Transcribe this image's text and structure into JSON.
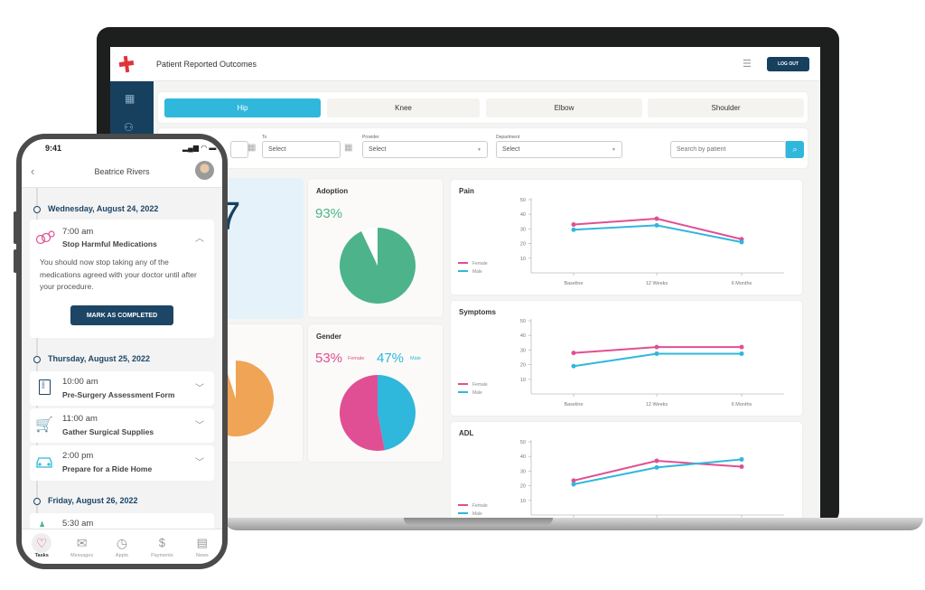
{
  "app": {
    "title": "Patient Reported Outcomes",
    "logout_label": "LOG OUT",
    "brand_color": "#e0343a",
    "accent": "#2fb8dc",
    "navy": "#17405f"
  },
  "tabs": [
    {
      "label": "Hip",
      "active": true
    },
    {
      "label": "Knee"
    },
    {
      "label": "Elbow"
    },
    {
      "label": "Shoulder"
    }
  ],
  "filters": {
    "to_label": "To",
    "to_value": "Select",
    "provider_label": "Provider",
    "provider_value": "Select",
    "department_label": "Department",
    "department_value": "Select",
    "search_placeholder": "Search by patient"
  },
  "stat_card": {
    "value_fragment": "7"
  },
  "adoption": {
    "title": "Adoption",
    "value": "93%",
    "percent": 93,
    "color": "#4db38a"
  },
  "orange_pie": {
    "percent": 95,
    "color": "#f0a456"
  },
  "gender": {
    "title": "Gender",
    "female_value": "53%",
    "female_label": "Female",
    "male_value": "47%",
    "male_label": "Male",
    "female_percent": 53,
    "male_percent": 47,
    "female_color": "#e04f93",
    "male_color": "#2fb7dc"
  },
  "chart_data": [
    {
      "type": "line",
      "title": "Pain",
      "categories": [
        "Baseline",
        "12 Weeks",
        "6 Months"
      ],
      "yticks": [
        "10",
        "20",
        "30",
        "40",
        "50"
      ],
      "ylim": [
        0,
        50
      ],
      "legend": "left",
      "series": [
        {
          "name": "Female",
          "color": "#e04f93",
          "values": [
            33,
            37,
            23
          ]
        },
        {
          "name": "Male",
          "color": "#2fb7dc",
          "values": [
            29.5,
            32.5,
            21
          ]
        }
      ]
    },
    {
      "type": "line",
      "title": "Symptoms",
      "categories": [
        "Baseline",
        "12 Weeks",
        "6 Months"
      ],
      "yticks": [
        "10",
        "20",
        "30",
        "40",
        "50"
      ],
      "ylim": [
        0,
        50
      ],
      "legend": "left",
      "series": [
        {
          "name": "Female",
          "color": "#e04f93",
          "values": [
            28,
            32,
            32
          ]
        },
        {
          "name": "Male",
          "color": "#2fb7dc",
          "values": [
            19,
            27.5,
            27.5
          ]
        }
      ]
    },
    {
      "type": "line",
      "title": "ADL",
      "categories": [
        "Baseline",
        "12 Weeks",
        "6 Months"
      ],
      "yticks": [
        "10",
        "20",
        "30",
        "40",
        "50"
      ],
      "ylim": [
        0,
        50
      ],
      "legend": "left",
      "series": [
        {
          "name": "Female",
          "color": "#e04f93",
          "values": [
            23.5,
            37,
            33
          ]
        },
        {
          "name": "Male",
          "color": "#2fb7dc",
          "values": [
            21,
            32.5,
            38
          ]
        }
      ]
    }
  ],
  "phone": {
    "status_time": "9:41",
    "patient_name": "Beatrice Rivers",
    "days": [
      {
        "date": "Wednesday, August 24, 2022"
      },
      {
        "date": "Thursday, August 25, 2022"
      },
      {
        "date": "Friday, August 26, 2022"
      }
    ],
    "task1": {
      "time": "7:00 am",
      "title": "Stop Harmful Medications",
      "body": "You should now stop taking any of the medications agreed with your doctor until after your procedure.",
      "button": "MARK AS COMPLETED"
    },
    "task2": {
      "time": "10:00 am",
      "title": "Pre-Surgery Assessment Form"
    },
    "task3": {
      "time": "11:00 am",
      "title": "Gather Surgical Supplies"
    },
    "task4": {
      "time": "2:00 pm",
      "title": "Prepare for a Ride Home"
    },
    "task5": {
      "time": "5:30 am"
    },
    "nav": [
      {
        "label": "Tasks",
        "active": true
      },
      {
        "label": "Messages"
      },
      {
        "label": "Appts"
      },
      {
        "label": "Payments"
      },
      {
        "label": "News"
      }
    ]
  }
}
